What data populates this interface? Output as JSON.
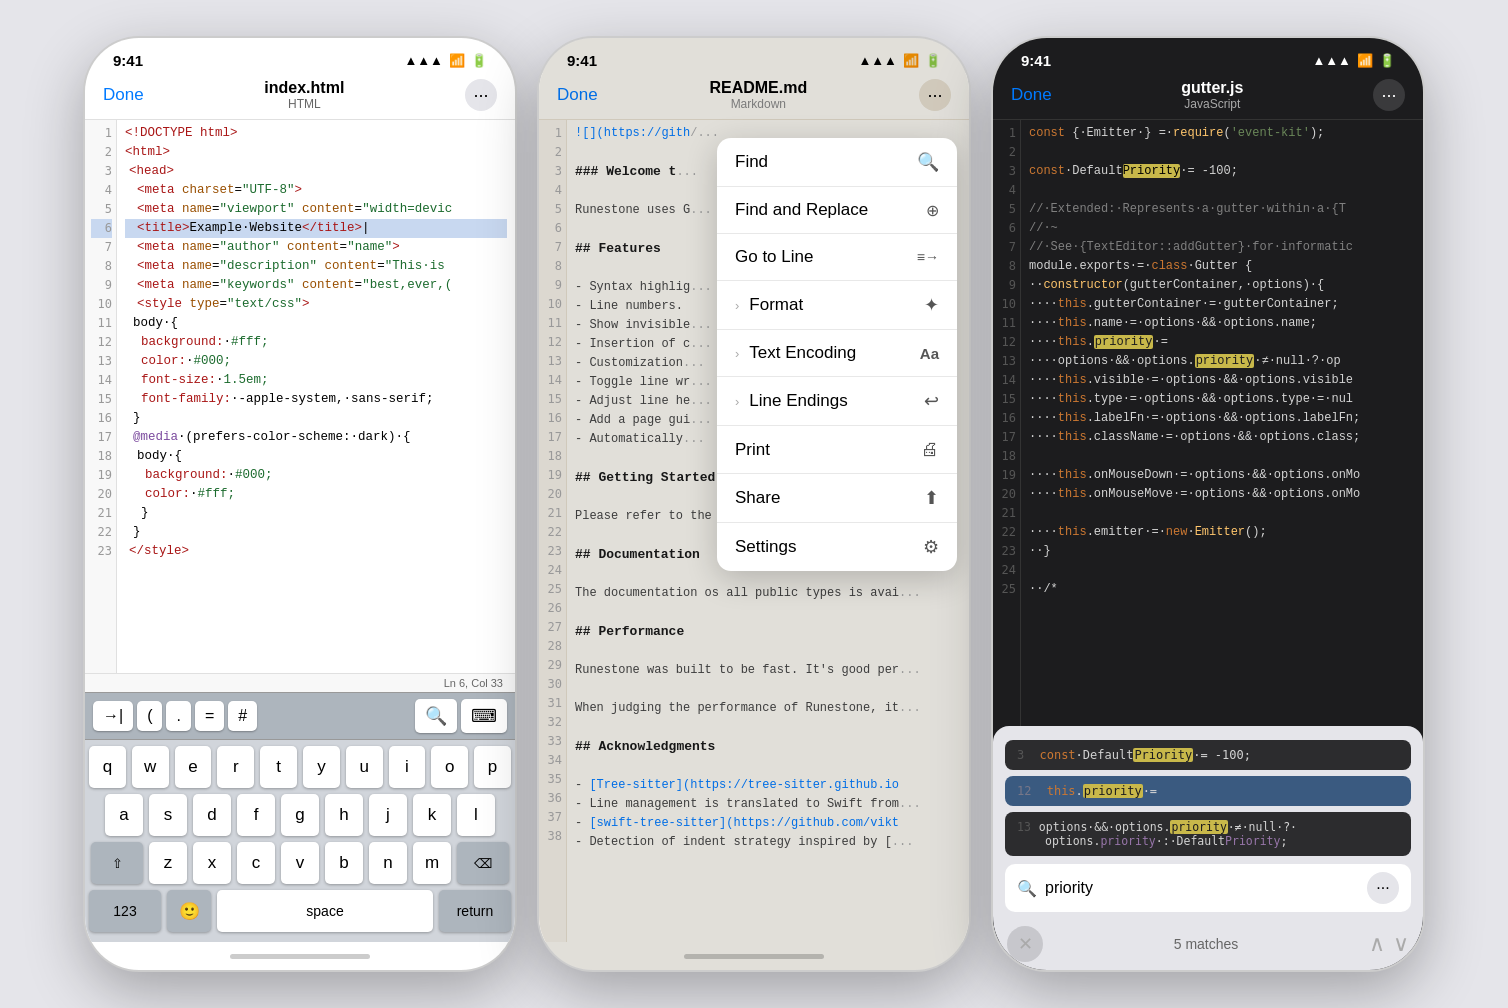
{
  "phones": [
    {
      "id": "html-phone",
      "theme": "light",
      "status": {
        "time": "9:41",
        "signal": "●●●",
        "wifi": "WiFi",
        "battery": "🔋"
      },
      "nav": {
        "done": "Done",
        "title": "index.html",
        "subtitle": "HTML",
        "more": "···"
      },
      "lines": [
        {
          "n": 1,
          "text": "<!DOCTYPE·html>"
        },
        {
          "n": 2,
          "text": "<html>"
        },
        {
          "n": 3,
          "text": "  <head>"
        },
        {
          "n": 4,
          "text": "    <meta·charset=\"UTF-8\">"
        },
        {
          "n": 5,
          "text": "    <meta·name=\"viewport\"·content=\"width=devic"
        },
        {
          "n": 6,
          "text": "    <title>Example·Website</title>",
          "active": true
        },
        {
          "n": 7,
          "text": "    <meta·name=\"author\"·content=\"name\">"
        },
        {
          "n": 8,
          "text": "    <meta·name=\"description\"·content=\"This·is"
        },
        {
          "n": 9,
          "text": "    <meta·name=\"keywords\"·content=\"best,ever,("
        },
        {
          "n": 10,
          "text": "    <style·type=\"text/css\">"
        },
        {
          "n": 11,
          "text": "    body·{"
        },
        {
          "n": 12,
          "text": "      background:·#fff;"
        },
        {
          "n": 13,
          "text": "      color:·#000;"
        },
        {
          "n": 14,
          "text": "      font-size:·1.5em;"
        },
        {
          "n": 15,
          "text": "      font-family:·-apple-system,·sans-serif;"
        },
        {
          "n": 16,
          "text": "    }"
        },
        {
          "n": 17,
          "text": "    @media·(prefers-color-scheme:·dark)·{"
        },
        {
          "n": 18,
          "text": "      body·{"
        },
        {
          "n": 19,
          "text": "        background:·#000;"
        },
        {
          "n": 20,
          "text": "        color:·#fff;"
        },
        {
          "n": 21,
          "text": "      }"
        },
        {
          "n": 22,
          "text": "    }"
        },
        {
          "n": 23,
          "text": "  </style>"
        }
      ],
      "status_line": "Ln 6, Col 33",
      "keyboard": {
        "toolbar": [
          "→|",
          "(",
          ".",
          "=",
          "#"
        ],
        "rows": [
          [
            "q",
            "w",
            "e",
            "r",
            "t",
            "y",
            "u",
            "i",
            "o",
            "p"
          ],
          [
            "a",
            "s",
            "d",
            "f",
            "g",
            "h",
            "j",
            "k",
            "l"
          ],
          [
            "⇧",
            "z",
            "x",
            "c",
            "v",
            "b",
            "n",
            "m",
            "⌫"
          ],
          [
            "123",
            "🙂",
            "space",
            "return"
          ]
        ]
      }
    },
    {
      "id": "md-phone",
      "theme": "markdown",
      "status": {
        "time": "9:41",
        "signal": "●●●",
        "wifi": "WiFi",
        "battery": "🔋"
      },
      "nav": {
        "done": "Done",
        "title": "README.md",
        "subtitle": "Markdown",
        "more": "···"
      },
      "lines": [
        {
          "n": 1,
          "text": "![](https://gith"
        },
        {
          "n": 2,
          "text": ""
        },
        {
          "n": 3,
          "text": "### Welcome t"
        },
        {
          "n": 4,
          "text": ""
        },
        {
          "n": 5,
          "text": "Runestone uses G"
        },
        {
          "n": 6,
          "text": ""
        },
        {
          "n": 7,
          "text": "## Features"
        },
        {
          "n": 8,
          "text": ""
        },
        {
          "n": 9,
          "text": "- Syntax highlig"
        },
        {
          "n": 10,
          "text": "- Line numbers."
        },
        {
          "n": 11,
          "text": "- Show invisible"
        },
        {
          "n": 12,
          "text": "- Insertion of c"
        },
        {
          "n": 13,
          "text": "- Customization"
        },
        {
          "n": 14,
          "text": "- Toggle line wr"
        },
        {
          "n": 15,
          "text": "- Adjust line he"
        },
        {
          "n": 16,
          "text": "- Add a page gui"
        },
        {
          "n": 17,
          "text": "- Automatically"
        },
        {
          "n": 18,
          "text": ""
        },
        {
          "n": 19,
          "text": "## Getting Started"
        },
        {
          "n": 20,
          "text": ""
        },
        {
          "n": 21,
          "text": "Please refer to the [Getting Started](https:/"
        },
        {
          "n": 22,
          "text": ""
        },
        {
          "n": 23,
          "text": "## Documentation"
        },
        {
          "n": 24,
          "text": ""
        },
        {
          "n": 25,
          "text": "The documentation os all public types is avai"
        },
        {
          "n": 26,
          "text": ""
        },
        {
          "n": 27,
          "text": "## Performance"
        },
        {
          "n": 28,
          "text": ""
        },
        {
          "n": 29,
          "text": "Runestone was built to be fast. It's good per"
        },
        {
          "n": 30,
          "text": ""
        },
        {
          "n": 31,
          "text": "When judging the performance of Runestone, it"
        },
        {
          "n": 32,
          "text": ""
        },
        {
          "n": 33,
          "text": "## Acknowledgments"
        },
        {
          "n": 34,
          "text": ""
        },
        {
          "n": 35,
          "text": "- [Tree-sitter](https://tree-sitter.github.io"
        },
        {
          "n": 36,
          "text": "- Line management is translated to Swift from"
        },
        {
          "n": 37,
          "text": "- [swift-tree-sitter](https://github.com/vikt"
        },
        {
          "n": 38,
          "text": "- Detection of indent strategy inspired by ["
        }
      ],
      "menu": {
        "items": [
          {
            "label": "Find",
            "icon": "🔍",
            "chevron": false
          },
          {
            "label": "Find and Replace",
            "icon": "⊕",
            "chevron": false
          },
          {
            "label": "Go to Line",
            "icon": "≡→",
            "chevron": false
          },
          {
            "label": "Format",
            "icon": "✦",
            "chevron": true
          },
          {
            "label": "Text Encoding",
            "icon": "Aa",
            "chevron": true
          },
          {
            "label": "Line Endings",
            "icon": "↩",
            "chevron": true
          },
          {
            "label": "Print",
            "icon": "🖨",
            "chevron": false
          },
          {
            "label": "Share",
            "icon": "⬆",
            "chevron": false
          },
          {
            "label": "Settings",
            "icon": "⚙",
            "chevron": false
          }
        ]
      }
    },
    {
      "id": "js-phone",
      "theme": "dark",
      "status": {
        "time": "9:41",
        "signal": "●●●",
        "wifi": "WiFi",
        "battery": "🔋"
      },
      "nav": {
        "done": "Done",
        "title": "gutter.js",
        "subtitle": "JavaScript",
        "more": "···"
      },
      "lines": [
        {
          "n": 1,
          "text": "const·{·Emitter·}·=·require('event-kit');"
        },
        {
          "n": 2,
          "text": ""
        },
        {
          "n": 3,
          "text": "const·DefaultPriority·=·-100;"
        },
        {
          "n": 4,
          "text": ""
        },
        {
          "n": 5,
          "text": "//·Extended:·Represents·a·gutter·within·a·{T"
        },
        {
          "n": 6,
          "text": "//·~"
        },
        {
          "n": 7,
          "text": "//·See·{TextEditor::addGutter}·for·informatic"
        },
        {
          "n": 8,
          "text": "module.exports·=·class·Gutter·{"
        },
        {
          "n": 9,
          "text": "··constructor(gutterContainer,·options)·{"
        },
        {
          "n": 10,
          "text": "    this.gutterContainer·=·gutterContainer;"
        },
        {
          "n": 11,
          "text": "    this.name·=·options·&&·options.name;"
        },
        {
          "n": 12,
          "text": "    this.priority·=·"
        },
        {
          "n": 13,
          "text": "    ··options·&&·options.priority·≠·null·?·op"
        },
        {
          "n": 14,
          "text": "    this.visible·=·options·&&·options.visible"
        },
        {
          "n": 15,
          "text": "    this.type·=·options·&&·options.type·=·nul"
        },
        {
          "n": 16,
          "text": "    this.labelFn·=·options·&&·options.labelFn;"
        },
        {
          "n": 17,
          "text": "    this.className·=·options·&&·options.class;"
        },
        {
          "n": 18,
          "text": ""
        },
        {
          "n": 19,
          "text": "    this.onMouseDown·=·options·&&·options.onMo"
        },
        {
          "n": 20,
          "text": "    this.onMouseMove·=·options·&&·options.onMo"
        },
        {
          "n": 21,
          "text": ""
        },
        {
          "n": 22,
          "text": "    this.emitter·=·new·Emitter();"
        },
        {
          "n": 23,
          "text": "  ·}"
        },
        {
          "n": 24,
          "text": ""
        },
        {
          "n": 25,
          "text": "  ··/*"
        }
      ],
      "find": {
        "query": "priority",
        "matches": "5 matches",
        "results": [
          {
            "line": 3,
            "text": "const·DefaultPriority·=·-100;",
            "highlight": "Priority"
          },
          {
            "line": 12,
            "text": "this.priority·=",
            "highlight": "priority",
            "active": true
          },
          {
            "line": 13,
            "text": "options·&&·options.priority·≠·null·?·",
            "highlight": "priority",
            "extra": "options.priority·:·DefaultPriority;"
          }
        ]
      }
    }
  ],
  "icons": {
    "signal": "▲▲▲",
    "wifi": "WiFi",
    "battery": "▐▌"
  }
}
